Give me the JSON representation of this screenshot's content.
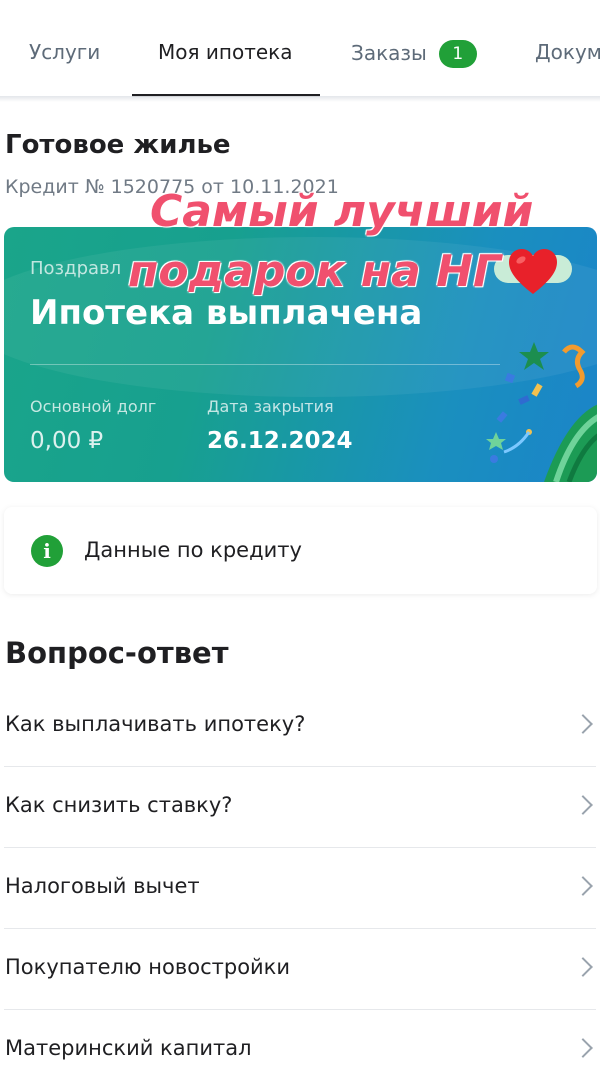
{
  "tabs": [
    {
      "label": "Услуги"
    },
    {
      "label": "Моя ипотека"
    },
    {
      "label": "Заказы",
      "badge": "1"
    },
    {
      "label": "Докум"
    }
  ],
  "section": {
    "title": "Готовое жилье",
    "credit_line": "Кредит № 1520775 от 10.11.2021"
  },
  "card": {
    "greeting": "Поздравл",
    "headline": "Ипотека выплачена",
    "debt_label": "Основной долг",
    "debt_value": "0,00 ₽",
    "close_label": "Дата закрытия",
    "close_value": "26.12.2024",
    "gradient_from": "#1aa58a",
    "gradient_to": "#1b84c9"
  },
  "sticker": {
    "line1": "Самый лучший",
    "line2": "подарок на НГ",
    "icon": "heart-emoji",
    "color": "#f0506e"
  },
  "info": {
    "icon": "info-icon",
    "label": "Данные по кредиту",
    "accent": "#21a038"
  },
  "faq": {
    "title": "Вопрос-ответ",
    "items": [
      {
        "label": "Как выплачивать ипотеку?"
      },
      {
        "label": "Как снизить ставку?"
      },
      {
        "label": "Налоговый вычет"
      },
      {
        "label": "Покупателю новостройки"
      },
      {
        "label": "Материнский капитал"
      }
    ]
  }
}
